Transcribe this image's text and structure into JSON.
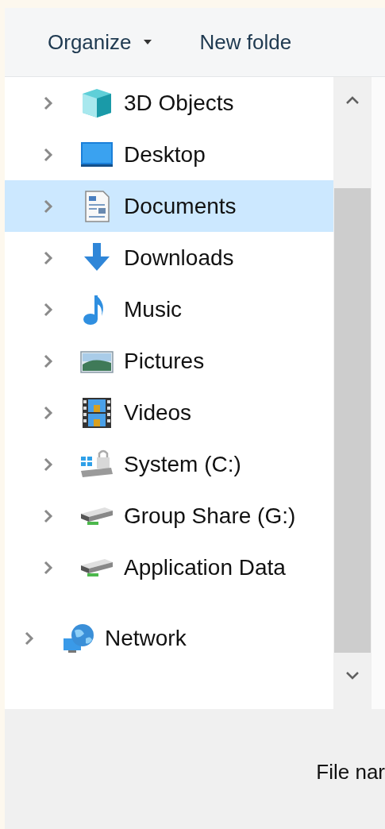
{
  "toolbar": {
    "items": [
      {
        "label": "Organize",
        "kind": "menu"
      },
      {
        "label": "New folde",
        "kind": "button"
      }
    ]
  },
  "tree": [
    {
      "children": [
        {
          "label": "3D Objects",
          "kind": "cube",
          "expanded": false,
          "selected": false
        },
        {
          "label": "Desktop",
          "kind": "desktop",
          "expanded": false,
          "selected": false
        },
        {
          "label": "Documents",
          "kind": "documents",
          "expanded": false,
          "selected": true
        },
        {
          "label": "Downloads",
          "kind": "downloads",
          "expanded": false,
          "selected": false
        },
        {
          "label": "Music",
          "kind": "music",
          "expanded": false,
          "selected": false
        },
        {
          "label": "Pictures",
          "kind": "pictures",
          "expanded": false,
          "selected": false
        },
        {
          "label": "Videos",
          "kind": "videos",
          "expanded": false,
          "selected": false
        },
        {
          "label": "System (C:)",
          "kind": "system-drive",
          "expanded": false,
          "selected": false
        },
        {
          "label": "Group Share (G:)",
          "kind": "drive",
          "expanded": false,
          "selected": false
        },
        {
          "label": "Application Data",
          "kind": "drive",
          "expanded": false,
          "selected": false
        }
      ]
    },
    {
      "label": "Network",
      "kind": "network",
      "expanded": false,
      "selected": false
    }
  ],
  "footer": {
    "file_name_label": "File nar"
  }
}
